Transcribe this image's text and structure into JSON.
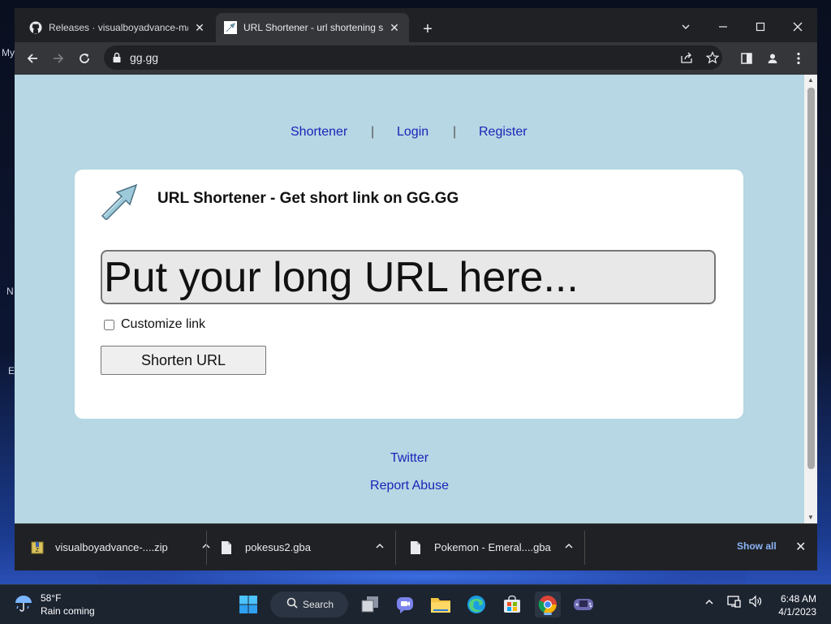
{
  "desktop": {
    "labels": [
      "My",
      "N",
      "E"
    ]
  },
  "browser": {
    "tabs": [
      {
        "title": "Releases · visualboyadvance-m/v",
        "icon": "github-icon"
      },
      {
        "title": "URL Shortener - url shortening se",
        "icon": "url-shortener-favicon"
      }
    ],
    "address": "gg.gg"
  },
  "page": {
    "nav": {
      "shortener": "Shortener",
      "login": "Login",
      "register": "Register",
      "separator": "|"
    },
    "title": "URL Shortener - Get short link on GG.GG",
    "url_placeholder": "Put your long URL here...",
    "customize_label": "Customize link",
    "shorten_label": "Shorten URL",
    "footer": {
      "twitter": "Twitter",
      "report": "Report Abuse"
    }
  },
  "downloads": {
    "items": [
      {
        "name": "visualboyadvance-....zip",
        "icon": "zip-file-icon"
      },
      {
        "name": "pokesus2.gba",
        "icon": "file-icon"
      },
      {
        "name": "Pokemon - Emeral....gba",
        "icon": "file-icon"
      }
    ],
    "show_all": "Show all"
  },
  "taskbar": {
    "weather_temp": "58°F",
    "weather_desc": "Rain coming",
    "search_label": "Search",
    "time": "6:48 AM",
    "date": "4/1/2023"
  }
}
